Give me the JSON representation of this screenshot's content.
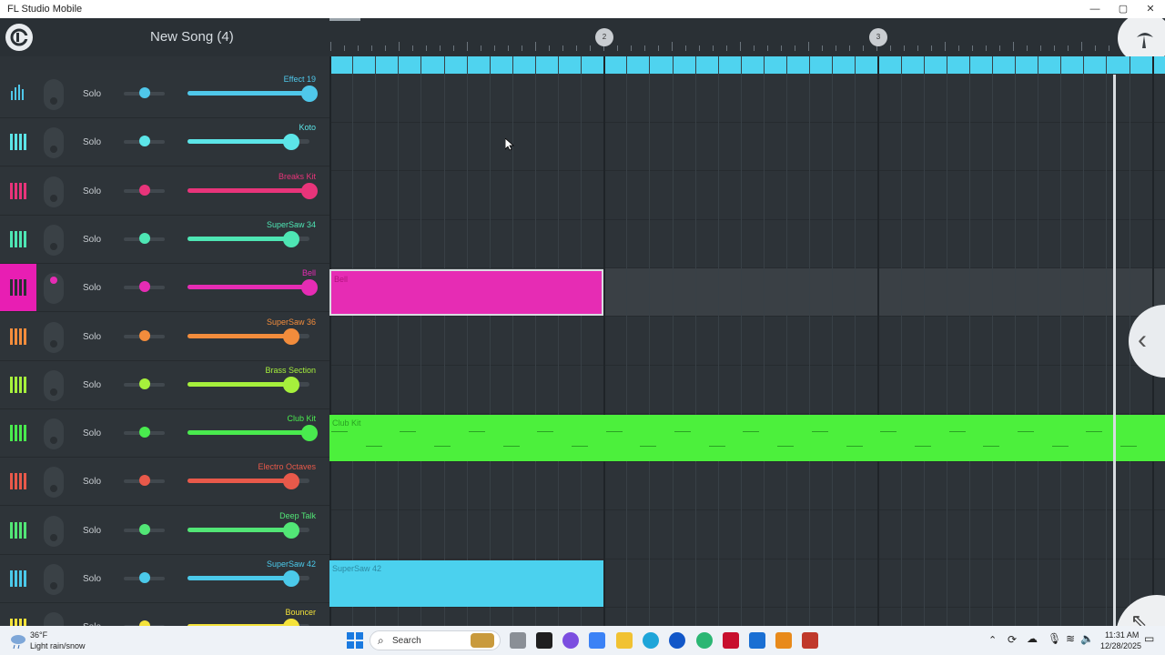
{
  "window": {
    "title": "FL Studio Mobile",
    "minimize": "—",
    "maximize": "▢",
    "close": "✕"
  },
  "header": {
    "song_title": "New Song (4)"
  },
  "ruler": {
    "markers": [
      "2",
      "3"
    ]
  },
  "tracks": [
    {
      "name": "Effect 19",
      "color": "#4fc7ea",
      "icon": "bars-icon",
      "solo": "Solo",
      "volume": 1.0,
      "pan": 0.5
    },
    {
      "name": "Koto",
      "color": "#5ce5e8",
      "icon": "piano-icon",
      "solo": "Solo",
      "volume": 0.85,
      "pan": 0.5
    },
    {
      "name": "Breaks Kit",
      "color": "#e8347a",
      "icon": "piano-icon",
      "solo": "Solo",
      "volume": 1.0,
      "pan": 0.5
    },
    {
      "name": "SuperSaw 34",
      "color": "#4ee6b4",
      "icon": "piano-icon",
      "solo": "Solo",
      "volume": 0.85,
      "pan": 0.5
    },
    {
      "name": "Bell",
      "color": "#e62cb4",
      "icon": "piano-icon",
      "solo": "Solo",
      "volume": 1.0,
      "pan": 0.5
    },
    {
      "name": "SuperSaw 36",
      "color": "#f28c3c",
      "icon": "piano-icon",
      "solo": "Solo",
      "volume": 0.85,
      "pan": 0.5
    },
    {
      "name": "Brass Section",
      "color": "#a6f03c",
      "icon": "piano-icon",
      "solo": "Solo",
      "volume": 0.85,
      "pan": 0.5
    },
    {
      "name": "Club Kit",
      "color": "#49ea4e",
      "icon": "piano-icon",
      "solo": "Solo",
      "volume": 1.0,
      "pan": 0.5
    },
    {
      "name": "Electro Octaves",
      "color": "#e8594a",
      "icon": "piano-icon",
      "solo": "Solo",
      "volume": 0.85,
      "pan": 0.5
    },
    {
      "name": "Deep Talk",
      "color": "#52e676",
      "icon": "piano-icon",
      "solo": "Solo",
      "volume": 0.85,
      "pan": 0.5
    },
    {
      "name": "SuperSaw 42",
      "color": "#4bc9ea",
      "icon": "piano-icon",
      "solo": "Solo",
      "volume": 0.85,
      "pan": 0.5
    },
    {
      "name": "Bouncer",
      "color": "#f4e23a",
      "icon": "piano-icon",
      "solo": "Solo",
      "volume": 0.85,
      "pan": 0.5
    }
  ],
  "clips": [
    {
      "label": "Bell",
      "track": 4,
      "color": "#e62cb4",
      "text_color": "#b3127f"
    },
    {
      "label": "Club Kit",
      "track": 7,
      "color": "#4cf03c",
      "text_color": "#2aa223"
    },
    {
      "label": "SuperSaw 42",
      "track": 10,
      "color": "#4bd1ee",
      "text_color": "#2d8aa3"
    }
  ],
  "taskbar": {
    "weather_temp": "36°F",
    "weather_desc": "Light rain/snow",
    "search_label": "Search",
    "time": "11:31 AM",
    "date": "12/28/2025"
  }
}
